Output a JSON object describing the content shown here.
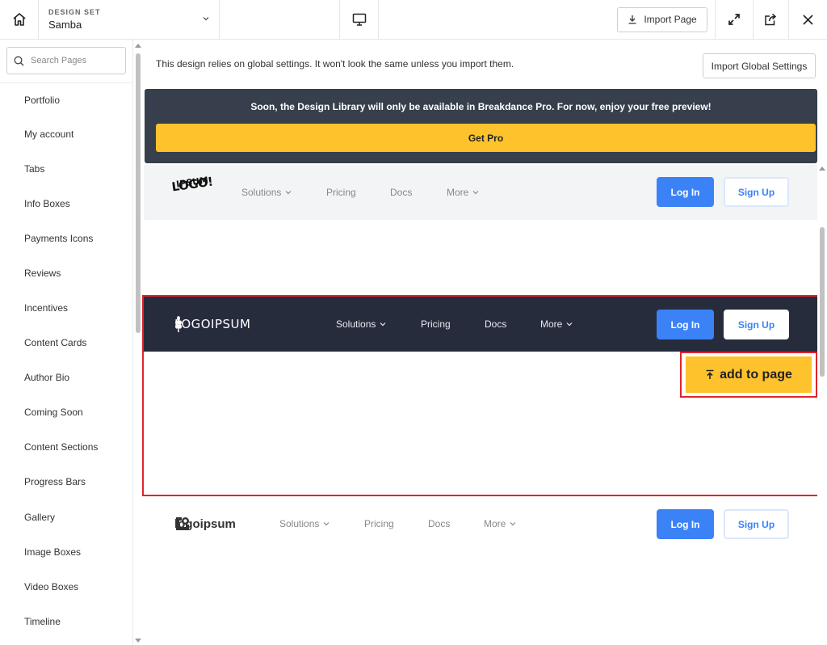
{
  "topbar": {
    "design_set_label": "DESIGN SET",
    "design_set_value": "Samba",
    "import_page_label": "Import Page"
  },
  "search": {
    "placeholder": "Search Pages"
  },
  "sidebar": {
    "items": [
      {
        "label": "Portfolio"
      },
      {
        "label": "My account"
      },
      {
        "label": "Tabs"
      },
      {
        "label": "Info Boxes"
      },
      {
        "label": "Payments Icons"
      },
      {
        "label": "Reviews"
      },
      {
        "label": "Incentives"
      },
      {
        "label": "Content Cards"
      },
      {
        "label": "Author Bio"
      },
      {
        "label": "Coming Soon"
      },
      {
        "label": "Content Sections"
      },
      {
        "label": "Progress Bars"
      },
      {
        "label": "Gallery"
      },
      {
        "label": "Image Boxes"
      },
      {
        "label": "Video Boxes"
      },
      {
        "label": "Timeline"
      }
    ]
  },
  "main": {
    "notice": "This design relies on global settings. It won't look the same unless you import them.",
    "import_global_label": "Import Global Settings",
    "pro_banner_text": "Soon, the Design Library will only be available in Breakdance Pro. For now, enjoy your free preview!",
    "get_pro_label": "Get Pro",
    "add_to_page_label": "add to page"
  },
  "headers": [
    {
      "logo_line1": "LOGO!",
      "logo_line2": "IPSUM",
      "nav": [
        "Solutions",
        "Pricing",
        "Docs",
        "More"
      ],
      "login": "Log In",
      "signup": "Sign Up"
    },
    {
      "logo": "LOGOIPSUM",
      "nav": [
        "Solutions",
        "Pricing",
        "Docs",
        "More"
      ],
      "login": "Log In",
      "signup": "Sign Up"
    },
    {
      "logo": "logoipsum",
      "nav": [
        "Solutions",
        "Pricing",
        "Docs",
        "More"
      ],
      "login": "Log In",
      "signup": "Sign Up"
    }
  ],
  "colors": {
    "accent_yellow": "#fec22d",
    "banner_dark": "#373f4c",
    "header_dark": "#272c3d",
    "button_blue": "#3b82f6",
    "selection_red": "#e0242a"
  }
}
